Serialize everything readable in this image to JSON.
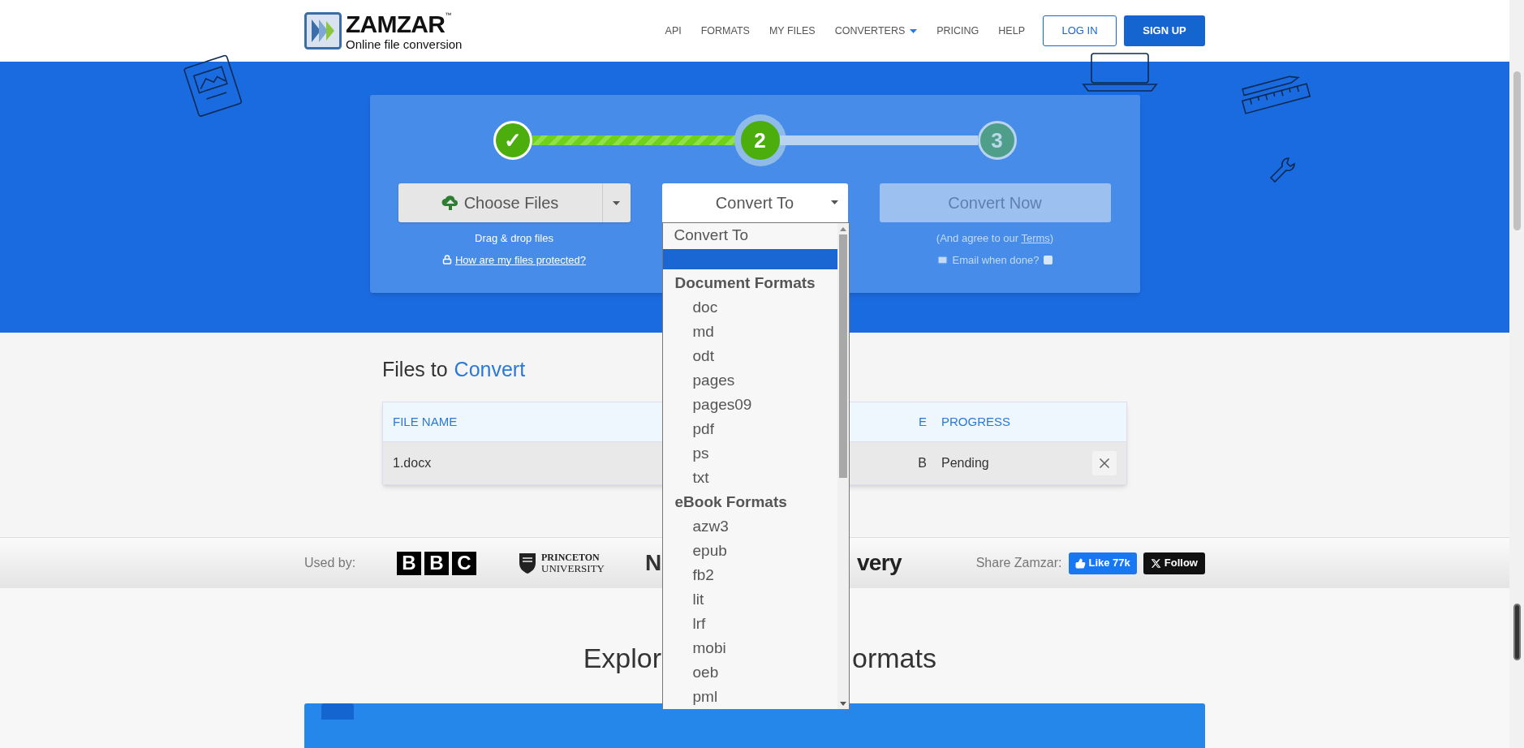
{
  "header": {
    "logo": {
      "name": "ZAMZAR",
      "tm": "™",
      "tagline": "Online file conversion"
    },
    "nav": [
      {
        "label": "API",
        "dropdown": false
      },
      {
        "label": "FORMATS",
        "dropdown": false
      },
      {
        "label": "MY FILES",
        "dropdown": false
      },
      {
        "label": "CONVERTERS",
        "dropdown": true
      },
      {
        "label": "PRICING",
        "dropdown": false
      },
      {
        "label": "HELP",
        "dropdown": false
      }
    ],
    "login": "LOG IN",
    "signup": "SIGN UP"
  },
  "steps": [
    {
      "label": "✓",
      "complete": true,
      "active": false
    },
    {
      "label": "2",
      "complete": false,
      "active": true
    },
    {
      "label": "3",
      "complete": false,
      "active": false
    }
  ],
  "choose_files": {
    "label": "Choose Files",
    "hint": "Drag & drop files",
    "protect_link": "How are my files protected?"
  },
  "convert_to": {
    "label": "Convert To",
    "expanded": true,
    "options": [
      {
        "kind": "option",
        "label": "Convert To",
        "selected": false
      },
      {
        "kind": "blank",
        "selected": true
      },
      {
        "kind": "heading",
        "label": "Document Formats"
      },
      {
        "kind": "option",
        "label": "doc",
        "selected": false
      },
      {
        "kind": "option",
        "label": "md",
        "selected": false
      },
      {
        "kind": "option",
        "label": "odt",
        "selected": false
      },
      {
        "kind": "option",
        "label": "pages",
        "selected": false
      },
      {
        "kind": "option",
        "label": "pages09",
        "selected": false
      },
      {
        "kind": "option",
        "label": "pdf",
        "selected": false
      },
      {
        "kind": "option",
        "label": "ps",
        "selected": false
      },
      {
        "kind": "option",
        "label": "txt",
        "selected": false
      },
      {
        "kind": "heading",
        "label": "eBook Formats"
      },
      {
        "kind": "option",
        "label": "azw3",
        "selected": false
      },
      {
        "kind": "option",
        "label": "epub",
        "selected": false
      },
      {
        "kind": "option",
        "label": "fb2",
        "selected": false
      },
      {
        "kind": "option",
        "label": "lit",
        "selected": false
      },
      {
        "kind": "option",
        "label": "lrf",
        "selected": false
      },
      {
        "kind": "option",
        "label": "mobi",
        "selected": false
      },
      {
        "kind": "option",
        "label": "oeb",
        "selected": false
      },
      {
        "kind": "option",
        "label": "pml",
        "selected": false
      }
    ]
  },
  "convert_now": {
    "label": "Convert Now",
    "disabled": true,
    "note_before": "(And agree to our ",
    "terms": "Terms",
    "note_after": ")",
    "email_label": "Email when done?",
    "email_checked": false
  },
  "files": {
    "title": "Files to",
    "title_accent": "Convert",
    "columns": [
      "FILE NAME",
      "E",
      "PROGRESS"
    ],
    "rows": [
      {
        "cells": [
          "1.docx",
          "B",
          "Pending"
        ]
      }
    ]
  },
  "used_by": {
    "label": "Used by:",
    "logos": [
      {
        "kind": "blocks",
        "letters": [
          "B",
          "B",
          "C"
        ]
      },
      {
        "kind": "crest",
        "lines": [
          "PRINCETON",
          "UNIVERSITY"
        ]
      },
      {
        "kind": "cut_end",
        "text": "N"
      },
      {
        "kind": "cut_start",
        "text": "very"
      }
    ],
    "share_label": "Share Zamzar:",
    "like": "Like 77k",
    "follow": "Follow"
  },
  "explore": {
    "parts": [
      "Explor",
      "ormats"
    ]
  }
}
